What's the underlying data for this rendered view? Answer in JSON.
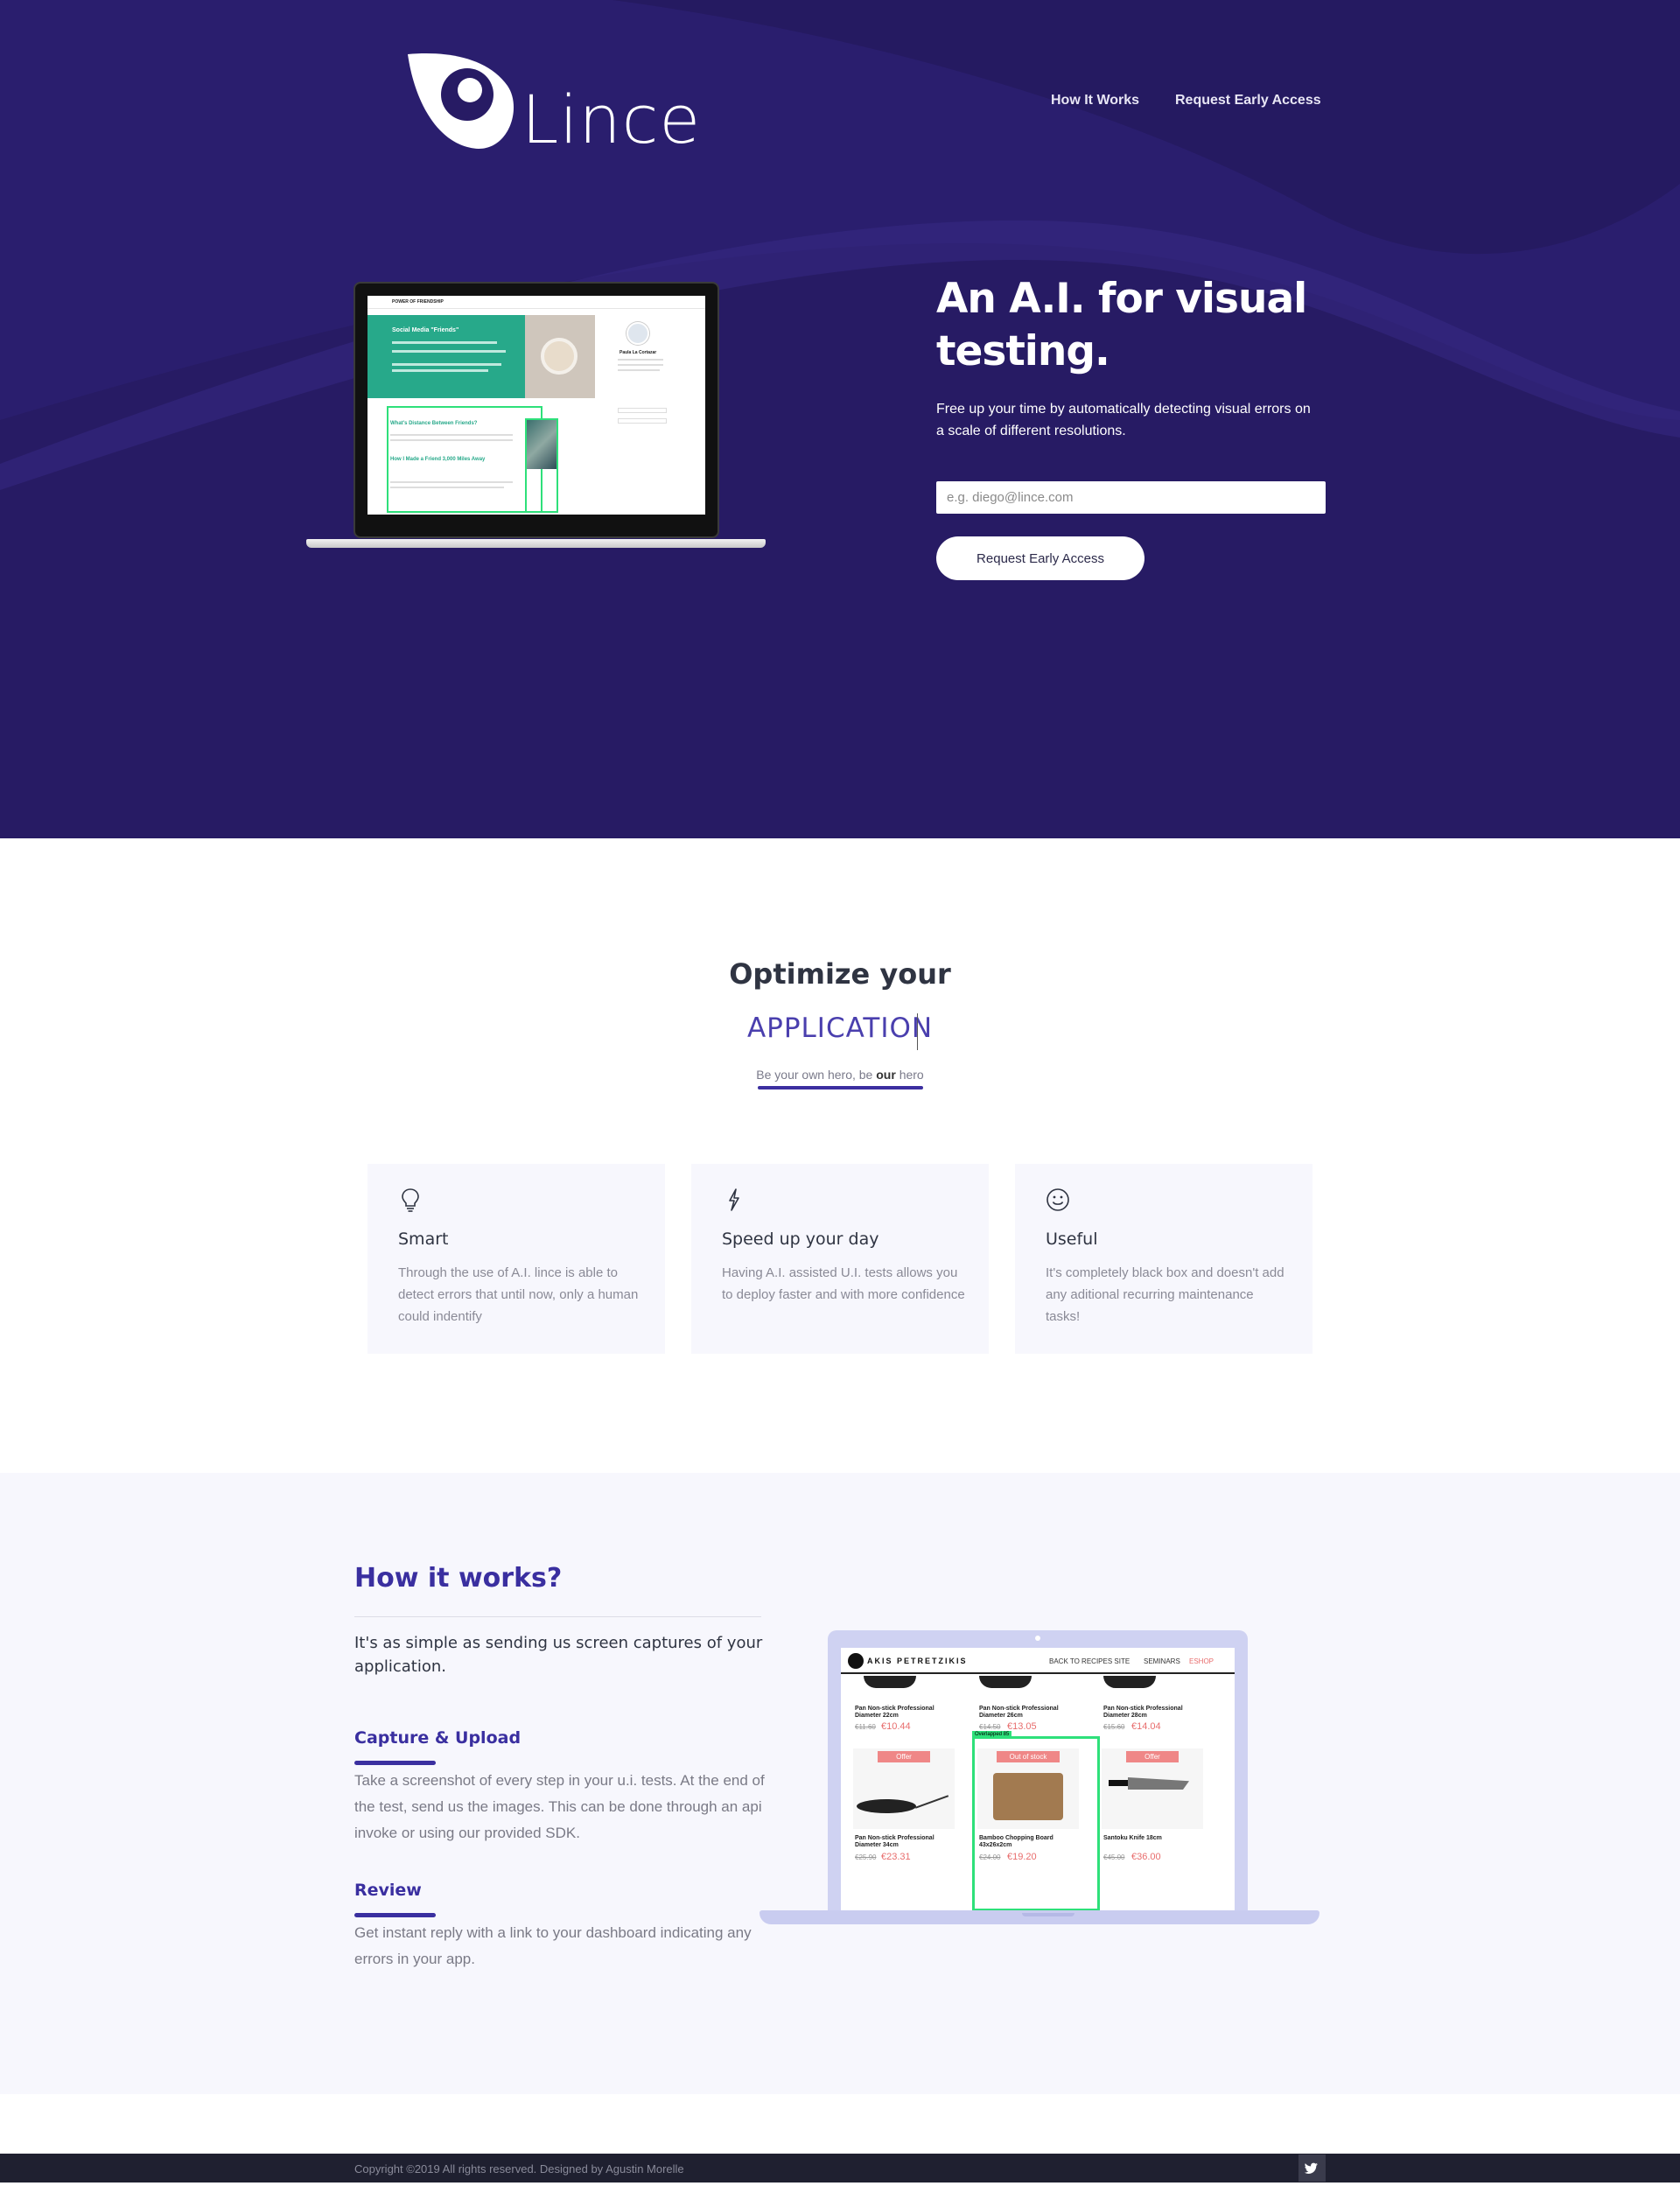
{
  "brand": {
    "name": "Lince"
  },
  "nav": {
    "how_it_works": "How It Works",
    "request_access": "Request Early Access"
  },
  "hero": {
    "title": "An A.I. for visual testing.",
    "subtitle": "Free up your time by automatically detecting visual errors on a scale of different resolutions.",
    "email_placeholder": "e.g. diego@lince.com",
    "button": "Request Early Access"
  },
  "hero_mock": {
    "site_title": "POWER OF FRIENDSHIP",
    "feature_title": "Social Media \"Friends\"",
    "post1": "What's Distance Between Friends?",
    "post2": "How I Made a Friend 3,000 Miles Away",
    "sidebar_name": "Paula La Cortazar",
    "colors": {
      "feature": "#27a98a",
      "detect": "#2ee07a"
    }
  },
  "optimize": {
    "title": "Optimize your",
    "word": "APPLICATION",
    "sub_pre": "Be your own hero, be ",
    "sub_bold": "our",
    "sub_post": " hero"
  },
  "features": [
    {
      "icon": "lightbulb-icon",
      "title": "Smart",
      "text": "Through the use of A.I. lince is able to detect errors that until now, only a human could indentify"
    },
    {
      "icon": "lightning-icon",
      "title": "Speed up your day",
      "text": "Having A.I. assisted U.I. tests allows you to deploy faster and with more confidence"
    },
    {
      "icon": "smiley-icon",
      "title": "Useful",
      "text": "It's completely black box and doesn't add any aditional recurring maintenance tasks!"
    }
  ],
  "how": {
    "title": "How it works?",
    "lead": "It's as simple as sending us screen captures of your application.",
    "steps": [
      {
        "title": "Capture & Upload",
        "text": "Take a screenshot of every step in your u.i. tests. At the end of the test, send us the images. This can be done through an api invoke or using our provided SDK."
      },
      {
        "title": "Review",
        "text": "Get instant reply with a link to your dashboard indicating any errors in your app."
      }
    ]
  },
  "shop_mock": {
    "brand": "AKIS PETRETZIKIS",
    "nav": [
      "BACK TO RECIPES SITE",
      "SEMINARS",
      "ESHOP"
    ],
    "detect_label": "Overlapped 85",
    "row1": [
      {
        "name": "Pan Non-stick Professional Diameter 22cm",
        "old": "€11.60",
        "price": "€10.44"
      },
      {
        "name": "Pan Non-stick Professional Diameter 26cm",
        "old": "€14.50",
        "price": "€13.05"
      },
      {
        "name": "Pan Non-stick Professional Diameter 28cm",
        "old": "€15.60",
        "price": "€14.04"
      }
    ],
    "row2": [
      {
        "badge": "Offer",
        "name": "Pan Non-stick Professional Diameter 34cm",
        "old": "€25.90",
        "price": "€23.31"
      },
      {
        "badge": "Out of stock",
        "name": "Bamboo Chopping Board 43x26x2cm",
        "old": "€24.00",
        "price": "€19.20"
      },
      {
        "badge": "Offer",
        "name": "Santoku Knife 18cm",
        "old": "€45.00",
        "price": "€36.00"
      }
    ]
  },
  "footer": {
    "copyright": "Copyright ©2019 All rights reserved. Designed by Agustin Morelle"
  }
}
